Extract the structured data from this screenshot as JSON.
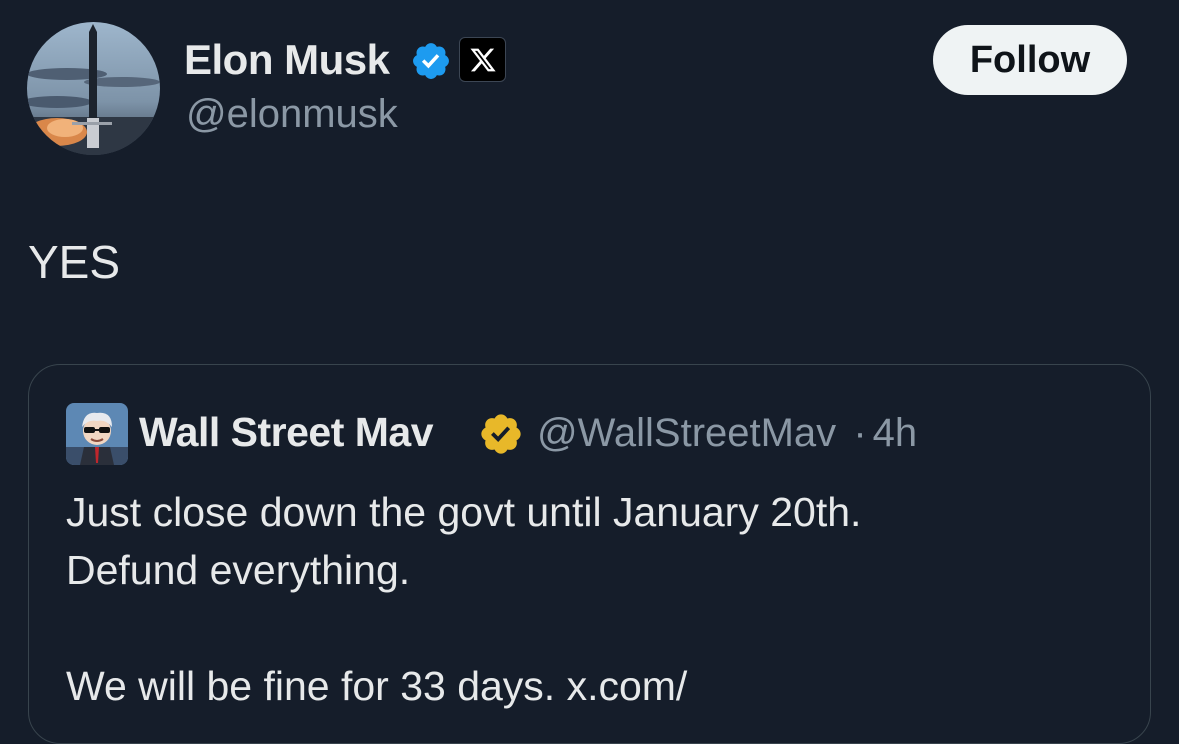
{
  "tweet": {
    "author": {
      "name": "Elon Musk",
      "handle": "@elonmusk",
      "verified_color": "#1d9bf0"
    },
    "follow_label": "Follow",
    "text": "YES"
  },
  "quote": {
    "author": {
      "name": "Wall Street Mav",
      "handle": "@WallStreetMav",
      "separator": "·",
      "time": "4h",
      "verified_color": "#e8b829"
    },
    "lines": [
      "Just close down the govt until January 20th.",
      "Defund everything.",
      "",
      "We will be fine for 33 days. x.com/"
    ]
  },
  "colors": {
    "background": "#151d2a",
    "primary_text": "#e7e9ea",
    "secondary_text": "#8b98a5",
    "border": "#38444d"
  }
}
